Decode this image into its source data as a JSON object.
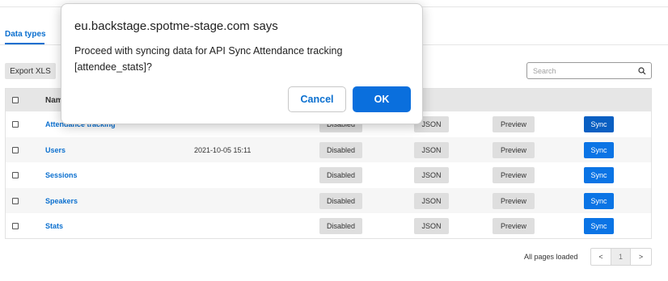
{
  "tabs": {
    "active_label": "Data types"
  },
  "toolbar": {
    "export_label": "Export XLS",
    "search_placeholder": "Search"
  },
  "table": {
    "header_name": "Name",
    "rows": [
      {
        "name": "Attendance tracking",
        "date": "",
        "status": "Disabled",
        "json": "JSON",
        "preview": "Preview",
        "sync": "Sync"
      },
      {
        "name": "Users",
        "date": "2021-10-05 15:11",
        "status": "Disabled",
        "json": "JSON",
        "preview": "Preview",
        "sync": "Sync"
      },
      {
        "name": "Sessions",
        "date": "",
        "status": "Disabled",
        "json": "JSON",
        "preview": "Preview",
        "sync": "Sync"
      },
      {
        "name": "Speakers",
        "date": "",
        "status": "Disabled",
        "json": "JSON",
        "preview": "Preview",
        "sync": "Sync"
      },
      {
        "name": "Stats",
        "date": "",
        "status": "Disabled",
        "json": "JSON",
        "preview": "Preview",
        "sync": "Sync"
      }
    ]
  },
  "footer": {
    "status": "All pages loaded",
    "prev": "<",
    "page": "1",
    "next": ">"
  },
  "dialog": {
    "title": "eu.backstage.spotme-stage.com says",
    "message": "Proceed with syncing data for API Sync Attendance tracking [attendee_stats]?",
    "cancel_label": "Cancel",
    "ok_label": "OK"
  },
  "colors": {
    "accent": "#0a6fdd",
    "link": "#0a6fcf",
    "sync_button": "#0b74e5"
  },
  "icons": {
    "search": "search-icon"
  }
}
